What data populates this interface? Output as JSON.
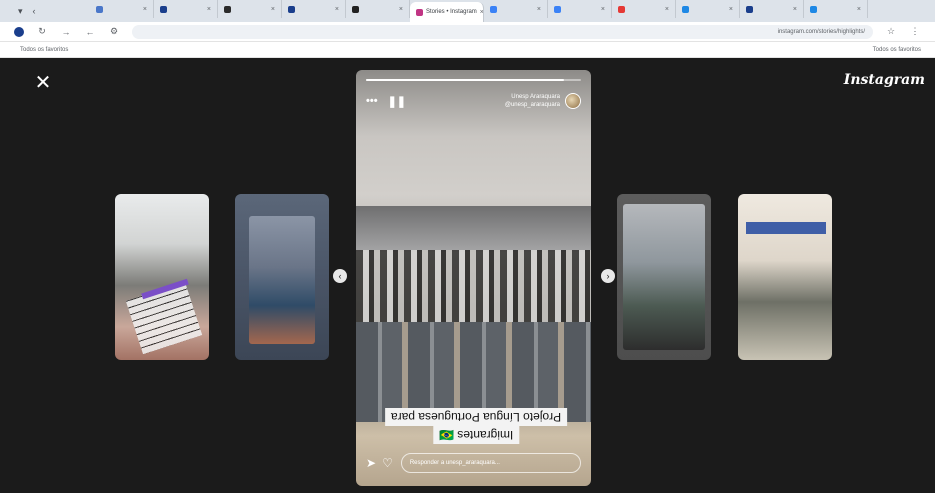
{
  "browser": {
    "tabs": [
      {
        "label": "",
        "color": "#4a77c9"
      },
      {
        "label": "",
        "color": "#1a3e8c"
      },
      {
        "label": "",
        "color": "#2b2b2b"
      },
      {
        "label": "",
        "color": "#1a3e8c"
      },
      {
        "label": "",
        "color": "#222222"
      },
      {
        "label": "Stories • Instagram",
        "color": "#c13584",
        "active": true
      },
      {
        "label": "",
        "color": "#3b82f6"
      },
      {
        "label": "",
        "color": "#3b82f6"
      },
      {
        "label": "",
        "color": "#e53935"
      },
      {
        "label": "",
        "color": "#1e88e5"
      },
      {
        "label": "",
        "color": "#1a3e8c"
      },
      {
        "label": "",
        "color": "#1e88e5"
      }
    ],
    "url": "instagram.com/stories/highlights/",
    "bookmarks_left": "Todos os favoritos",
    "bookmarks_right": "Todos os favoritos"
  },
  "viewer": {
    "logo": "Instagram",
    "progress": 0.92,
    "username": "Unesp Araraquara",
    "subtitle": "@unesp_araraquara",
    "caption_line1": "Projeto Língua Portuguesa para",
    "caption_line2": "Imigrantes 🇧🇷",
    "reply_placeholder": "Responder a unesp_araraquara..."
  },
  "colors": {
    "accent": "#ffffff",
    "background": "#1b1b1b"
  },
  "icons": [
    "close-icon",
    "pause-icon",
    "more-icon",
    "heart-icon",
    "send-icon",
    "chevron-left-icon",
    "chevron-right-icon"
  ]
}
